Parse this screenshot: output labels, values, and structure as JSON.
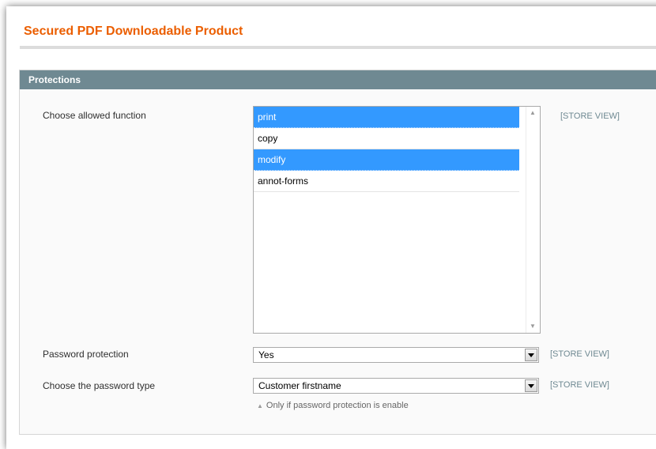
{
  "page": {
    "title": "Secured PDF Downloadable Product"
  },
  "fieldset": {
    "header": "Protections",
    "fields": {
      "allowed_function": {
        "label": "Choose allowed function",
        "scope": "[STORE VIEW]",
        "options": [
          {
            "label": "print",
            "selected": true
          },
          {
            "label": "copy",
            "selected": false
          },
          {
            "label": "modify",
            "selected": true
          },
          {
            "label": "annot-forms",
            "selected": false
          }
        ]
      },
      "password_protection": {
        "label": "Password protection",
        "value": "Yes",
        "scope": "[STORE VIEW]"
      },
      "password_type": {
        "label": "Choose the password type",
        "value": "Customer firstname",
        "scope": "[STORE VIEW]",
        "note": "Only if password protection is enable"
      }
    }
  },
  "colors": {
    "title": "#eb5e00",
    "header_bg": "#6f8992",
    "selection": "#3399ff",
    "scope": "#6f8992"
  }
}
